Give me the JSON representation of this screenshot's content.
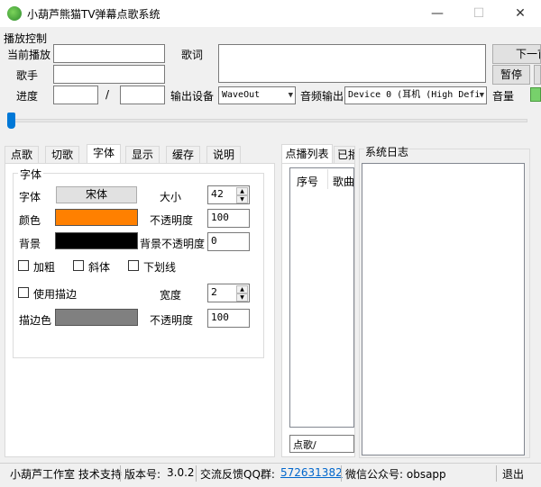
{
  "window": {
    "title": "小葫芦熊猫TV弹幕点歌系统",
    "min": "—",
    "max": "☐",
    "close": "✕"
  },
  "playback": {
    "group_label": "播放控制",
    "now_playing_label": "当前播放",
    "now_playing_value": "",
    "singer_label": "歌手",
    "singer_value": "",
    "progress_label": "进度",
    "progress_current": "",
    "progress_sep": "/",
    "progress_total": "",
    "lyrics_label": "歌词",
    "output_device_label": "输出设备",
    "output_device_value": "WaveOut",
    "audio_output_label": "音频输出",
    "audio_output_value": "Device 0 (耳机 (High Defi",
    "volume_label": "音量",
    "next_button": "下一首",
    "pause_button": "暂停",
    "slider_position": 0.0
  },
  "tabs": [
    "点歌",
    "切歌",
    "字体",
    "显示",
    "缓存",
    "说明"
  ],
  "active_tab": "字体",
  "font_panel": {
    "group_label": "字体",
    "font_label": "字体",
    "font_button": "宋体",
    "size_label": "大小",
    "size_value": "42",
    "color_label": "颜色",
    "color_hex": "#ff8000",
    "opacity_label": "不透明度",
    "opacity_value": "100",
    "bg_label": "背景",
    "bg_hex": "#000000",
    "bg_opacity_label": "背景不透明度",
    "bg_opacity_value": "0",
    "bold_label": "加粗",
    "italic_label": "斜体",
    "underline_label": "下划线",
    "outline_label": "使用描边",
    "width_label": "宽度",
    "width_value": "2",
    "outline_color_label": "描边色",
    "outline_color_hex": "#808080",
    "outline_opacity_label": "不透明度",
    "outline_opacity_value": "100"
  },
  "playlist": {
    "tabs": [
      "点播列表",
      "已播"
    ],
    "columns": [
      "序号",
      "歌曲"
    ],
    "input_value": "点歌/"
  },
  "log": {
    "label": "系统日志"
  },
  "status": {
    "studio": "小葫芦工作室 技术支持",
    "version_label": "版本号:",
    "version": "3.0.2",
    "qq_label": "交流反馈QQ群:",
    "qq": "572631382",
    "wechat_label": "微信公众号: obsapp",
    "exit": "退出"
  }
}
